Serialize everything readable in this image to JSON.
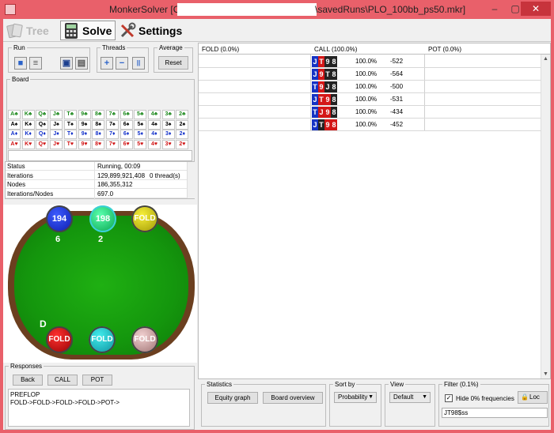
{
  "window": {
    "title_prefix": "MonkerSolver [C:\\",
    "title_suffix": "\\savedRuns\\PLO_100bb_ps50.mkr]",
    "min": "–",
    "max": "▢",
    "close": "✕"
  },
  "tabs": [
    {
      "label": "Tree",
      "icon": "tree-cards-icon"
    },
    {
      "label": "Solve",
      "icon": "calculator-icon"
    },
    {
      "label": "Settings",
      "icon": "tools-icon"
    }
  ],
  "run": {
    "legend": "Run",
    "threads_legend": "Threads",
    "average_legend": "Average",
    "reset_label": "Reset",
    "plus": "+",
    "minus": "−",
    "pause": "||"
  },
  "board": {
    "legend": "Board",
    "rows": [
      {
        "suit": "c",
        "cards": [
          "A♣",
          "K♣",
          "Q♣",
          "J♣",
          "T♣",
          "9♣",
          "8♣",
          "7♣",
          "6♣",
          "5♣",
          "4♣",
          "3♣",
          "2♣"
        ]
      },
      {
        "suit": "s",
        "cards": [
          "A♠",
          "K♠",
          "Q♠",
          "J♠",
          "T♠",
          "9♠",
          "8♠",
          "7♠",
          "6♠",
          "5♠",
          "4♠",
          "3♠",
          "2♠"
        ]
      },
      {
        "suit": "d",
        "cards": [
          "A♦",
          "K♦",
          "Q♦",
          "J♦",
          "T♦",
          "9♦",
          "8♦",
          "7♦",
          "6♦",
          "5♦",
          "4♦",
          "3♦",
          "2♦"
        ]
      },
      {
        "suit": "h",
        "cards": [
          "A♥",
          "K♥",
          "Q♥",
          "J♥",
          "T♥",
          "9♥",
          "8♥",
          "7♥",
          "6♥",
          "5♥",
          "4♥",
          "3♥",
          "2♥"
        ]
      }
    ]
  },
  "stats": [
    {
      "key": "Status",
      "value": "Running, 00:09",
      "extra": ""
    },
    {
      "key": "Iterations",
      "value": "129,899,921,408",
      "extra": "0 thread(s)"
    },
    {
      "key": "Nodes",
      "value": "186,355,312",
      "extra": ""
    },
    {
      "key": "Iterations/Nodes",
      "value": "697.0",
      "extra": ""
    }
  ],
  "seats": [
    {
      "label": "194",
      "sub": "6"
    },
    {
      "label": "198",
      "sub": "2"
    },
    {
      "label": "FOLD",
      "sub": ""
    },
    {
      "label": "FOLD",
      "sub": ""
    },
    {
      "label": "FOLD",
      "sub": ""
    },
    {
      "label": "FOLD",
      "sub": ""
    }
  ],
  "dealer": "D",
  "responses": {
    "legend": "Responses",
    "back": "Back",
    "call": "CALL",
    "pot": "POT",
    "log": "PREFLOP\nFOLD->FOLD->FOLD->FOLD->POT->"
  },
  "grid": {
    "headers": [
      "FOLD (0.0%)",
      "CALL (100.0%)",
      "POT (0.0%)"
    ],
    "rows": [
      {
        "cards": [
          [
            "J",
            "d"
          ],
          [
            "T",
            "h"
          ],
          [
            "9",
            "s"
          ],
          [
            "8",
            "s"
          ]
        ],
        "pct": "100.0%",
        "ev": "-522"
      },
      {
        "cards": [
          [
            "J",
            "d"
          ],
          [
            "9",
            "h"
          ],
          [
            "T",
            "s"
          ],
          [
            "8",
            "s"
          ]
        ],
        "pct": "100.0%",
        "ev": "-564"
      },
      {
        "cards": [
          [
            "T",
            "d"
          ],
          [
            "9",
            "h"
          ],
          [
            "J",
            "s"
          ],
          [
            "8",
            "s"
          ]
        ],
        "pct": "100.0%",
        "ev": "-500"
      },
      {
        "cards": [
          [
            "J",
            "d"
          ],
          [
            "T",
            "h"
          ],
          [
            "9",
            "h"
          ],
          [
            "8",
            "s"
          ]
        ],
        "pct": "100.0%",
        "ev": "-531"
      },
      {
        "cards": [
          [
            "T",
            "d"
          ],
          [
            "J",
            "h"
          ],
          [
            "9",
            "h"
          ],
          [
            "8",
            "s"
          ]
        ],
        "pct": "100.0%",
        "ev": "-434"
      },
      {
        "cards": [
          [
            "J",
            "d"
          ],
          [
            "T",
            "s"
          ],
          [
            "9",
            "h"
          ],
          [
            "8",
            "h"
          ]
        ],
        "pct": "100.0%",
        "ev": "-452"
      }
    ]
  },
  "bottom": {
    "statistics_legend": "Statistics",
    "equity_graph": "Equity graph",
    "board_overview": "Board overview",
    "sortby_legend": "Sort by",
    "sortby_value": "Probability",
    "view_legend": "View",
    "view_value": "Default",
    "filter_legend": "Filter (0.1%)",
    "hide_label": "Hide 0% frequencies",
    "lock_label": "Loc",
    "filter_value": "JT98$ss"
  }
}
